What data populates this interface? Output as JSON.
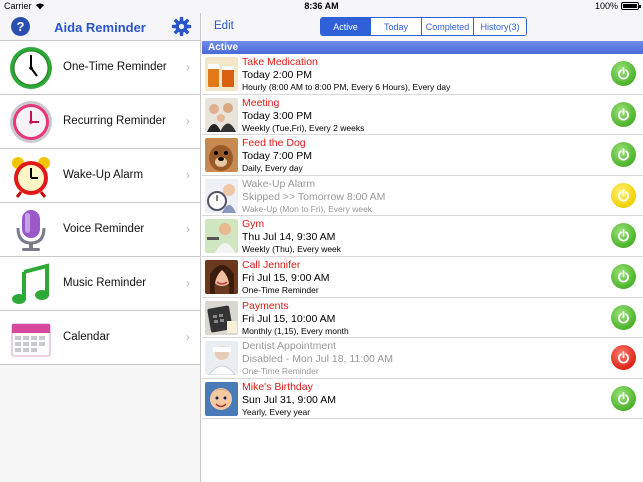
{
  "status_bar": {
    "carrier": "Carrier",
    "time": "8:36 AM",
    "battery": "100%"
  },
  "sidebar": {
    "title": "Aida Reminder",
    "help_label": "?",
    "items": [
      {
        "label": "One-Time Reminder",
        "icon": "clock-icon"
      },
      {
        "label": "Recurring Reminder",
        "icon": "recurring-clock-icon"
      },
      {
        "label": "Wake-Up Alarm",
        "icon": "alarm-clock-icon"
      },
      {
        "label": "Voice Reminder",
        "icon": "microphone-icon"
      },
      {
        "label": "Music Reminder",
        "icon": "music-note-icon"
      },
      {
        "label": "Calendar",
        "icon": "calendar-icon"
      }
    ]
  },
  "main": {
    "edit_label": "Edit",
    "tabs": [
      {
        "label": "Active",
        "active": true
      },
      {
        "label": "Today",
        "active": false
      },
      {
        "label": "Completed",
        "active": false
      },
      {
        "label": "History(3)",
        "active": false
      }
    ],
    "section_label": "Active",
    "reminders": [
      {
        "title": "Take Medication",
        "when": "Today 2:00 PM",
        "detail": "Hourly (8:00 AM to 8:00 PM, Every 6 Hours), Every day",
        "status": "green",
        "disabled": false,
        "thumb": "medication"
      },
      {
        "title": "Meeting",
        "when": "Today 3:00 PM",
        "detail": "Weekly (Tue,Fri), Every 2 weeks",
        "status": "green",
        "disabled": false,
        "thumb": "meeting"
      },
      {
        "title": "Feed the Dog",
        "when": "Today 7:00 PM",
        "detail": "Daily, Every day",
        "status": "green",
        "disabled": false,
        "thumb": "dog"
      },
      {
        "title": "Wake-Up Alarm",
        "when": "Skipped >> Tomorrow 8:00 AM",
        "detail": "Wake-Up (Mon to Fri), Every week",
        "status": "yellow",
        "disabled": true,
        "thumb": "wakeup"
      },
      {
        "title": "Gym",
        "when": "Thu Jul 14, 9:30 AM",
        "detail": "Weekly (Thu), Every week",
        "status": "green",
        "disabled": false,
        "thumb": "gym"
      },
      {
        "title": "Call Jennifer",
        "when": "Fri Jul 15, 9:00 AM",
        "detail": "One-Time Reminder",
        "status": "green",
        "disabled": false,
        "thumb": "jennifer"
      },
      {
        "title": "Payments",
        "when": "Fri Jul 15, 10:00 AM",
        "detail": "Monthly (1,15), Every month",
        "status": "green",
        "disabled": false,
        "thumb": "payments"
      },
      {
        "title": "Dentist Appointment",
        "when": "Disabled - Mon Jul 18, 11:00 AM",
        "detail": "One-Time Reminder",
        "status": "red",
        "disabled": true,
        "thumb": "dentist"
      },
      {
        "title": "Mike's Birthday",
        "when": "Sun Jul 31, 9:00 AM",
        "detail": "Yearly, Every year",
        "status": "green",
        "disabled": false,
        "thumb": "birthday"
      }
    ]
  }
}
